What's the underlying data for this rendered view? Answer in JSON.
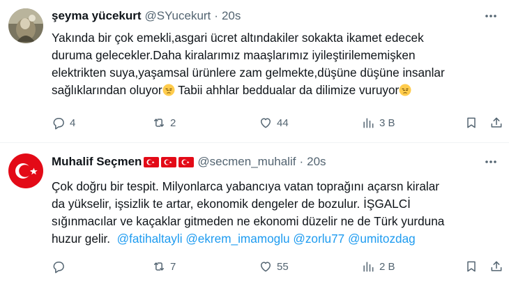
{
  "tweets": [
    {
      "author_name": "şeyma yücekurt",
      "handle": "@SYucekurt",
      "separator": "·",
      "time": "20s",
      "text_lines": [
        "Yakında bir çok emekli,asgari ücret altındakiler sokakta ikamet edecek",
        "duruma gelecekler.Daha kiralarımız  maaşlarımız iyileştirilememişken",
        "elektrikten suya,yaşamsal ürünlere zam gelmekte,düşüne düşüne insanlar"
      ],
      "last_line_part1": "sağlıklarından oluyor",
      "last_line_part2": " Tabii ahhlar beddualar da dilimize vuruyor",
      "emoji": "pensive-face",
      "counts": {
        "replies": "4",
        "reposts": "2",
        "likes": "44",
        "views": "3 B"
      }
    },
    {
      "author_name": "Muhalif Seçmen",
      "flags": [
        "turkey-flag",
        "turkey-flag",
        "turkey-flag"
      ],
      "handle": "@secmen_muhalif",
      "separator": "·",
      "time": "20s",
      "text_lines": [
        "Çok doğru bir tespit. Milyonlarca yabancıya vatan toprağını açarsn kiralar",
        "da yükselir, işsizlik te artar, ekonomik dengeler de bozulur. İŞGALCİ",
        "sığınmacılar ve kaçaklar gitmeden ne ekonomi düzelir ne de Türk yurduna"
      ],
      "last_line_text": "huzur gelir.",
      "mentions": [
        "@fatihaltayli",
        "@ekrem_imamoglu",
        "@zorlu77",
        "@umitozdag"
      ],
      "counts": {
        "replies": "",
        "reposts": "7",
        "likes": "55",
        "views": "2 B"
      }
    }
  ],
  "colors": {
    "text": "#0f1419",
    "secondary": "#536471",
    "link": "#1d9bf0",
    "divider": "#eff3f4",
    "flag_red": "#e30a17"
  }
}
